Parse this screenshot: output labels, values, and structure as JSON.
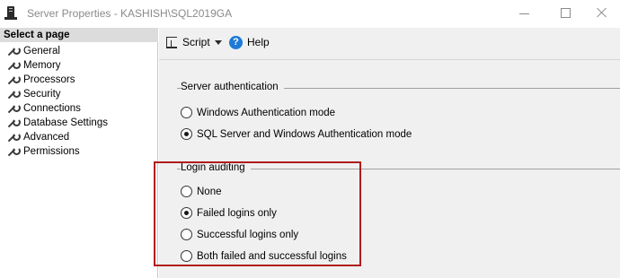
{
  "window": {
    "title": "Server Properties - KASHISH\\SQL2019GA"
  },
  "sidebar": {
    "header": "Select a page",
    "items": [
      {
        "label": "General"
      },
      {
        "label": "Memory"
      },
      {
        "label": "Processors"
      },
      {
        "label": "Security"
      },
      {
        "label": "Connections"
      },
      {
        "label": "Database Settings"
      },
      {
        "label": "Advanced"
      },
      {
        "label": "Permissions"
      }
    ]
  },
  "toolbar": {
    "script_label": "Script",
    "help_label": "Help"
  },
  "server_authentication": {
    "title": "Server authentication",
    "options": [
      {
        "label": "Windows Authentication mode",
        "selected": false
      },
      {
        "label": "SQL Server and Windows Authentication mode",
        "selected": true
      }
    ]
  },
  "login_auditing": {
    "title": "Login auditing",
    "options": [
      {
        "label": "None",
        "selected": false
      },
      {
        "label": "Failed logins only",
        "selected": true
      },
      {
        "label": "Successful logins only",
        "selected": false
      },
      {
        "label": "Both failed and successful logins",
        "selected": false
      }
    ]
  },
  "colors": {
    "highlight_box": "#b01b1b",
    "help_icon": "#1e7ad6"
  },
  "icons": {
    "app": "server-properties-icon",
    "sidebar_item": "wrench-icon",
    "script": "script-icon",
    "help": "help-icon"
  }
}
